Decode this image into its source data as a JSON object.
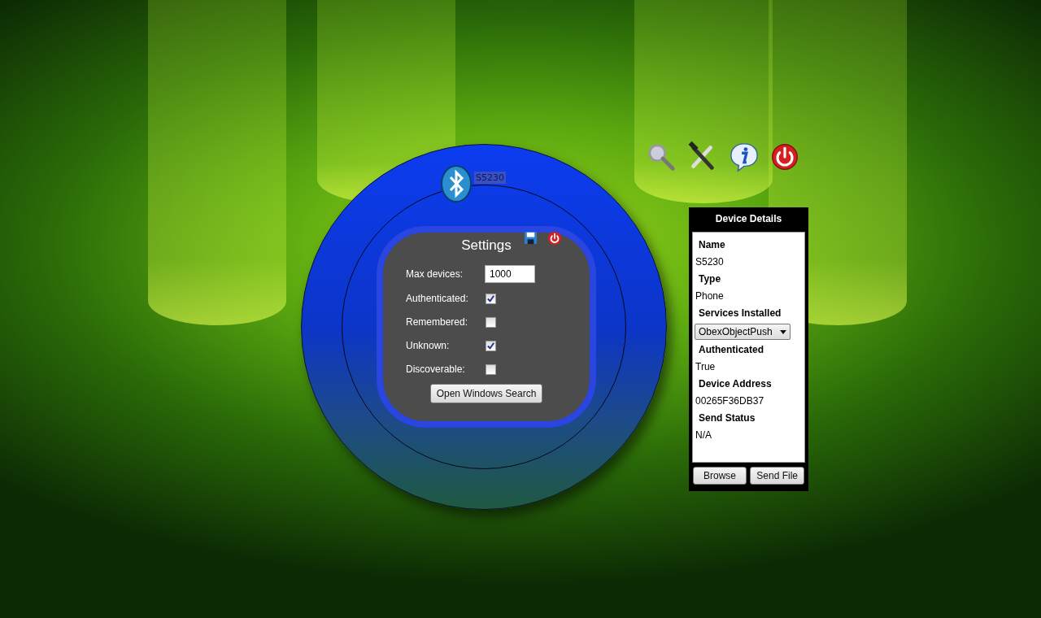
{
  "device_label": "S5230",
  "settings": {
    "title": "Settings",
    "max_devices": {
      "label": "Max devices:",
      "value": "1000"
    },
    "options": [
      {
        "label": "Authenticated:",
        "checked": true
      },
      {
        "label": "Remembered:",
        "checked": false
      },
      {
        "label": "Unknown:",
        "checked": true
      },
      {
        "label": "Discoverable:",
        "checked": false
      }
    ],
    "button": "Open Windows Search"
  },
  "device_details": {
    "title": "Device Details",
    "fields": [
      {
        "label": "Name",
        "value": "S5230",
        "kind": "text"
      },
      {
        "label": "Type",
        "value": "Phone",
        "kind": "text"
      },
      {
        "label": "Services Installed",
        "value": "ObexObjectPush",
        "kind": "dropdown"
      },
      {
        "label": "Authenticated",
        "value": "True",
        "kind": "text"
      },
      {
        "label": "Device Address",
        "value": "00265F36DB37",
        "kind": "text"
      },
      {
        "label": "Send Status",
        "value": "N/A",
        "kind": "text"
      }
    ],
    "buttons": [
      "Browse",
      "Send File"
    ]
  }
}
